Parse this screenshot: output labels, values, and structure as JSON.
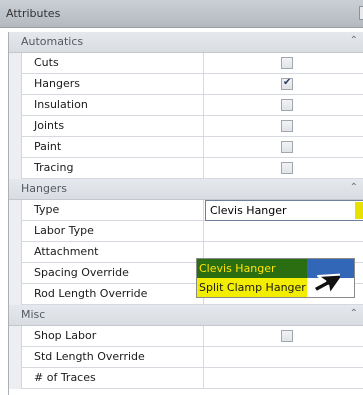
{
  "window": {
    "title": "Attributes"
  },
  "categories": {
    "automatics": {
      "label": "Automatics",
      "collapse_glyph": "⌃"
    },
    "hangers": {
      "label": "Hangers",
      "collapse_glyph": "⌃"
    },
    "misc": {
      "label": "Misc",
      "collapse_glyph": "⌃"
    }
  },
  "automatics_rows": [
    {
      "label": "Cuts",
      "checked": false
    },
    {
      "label": "Hangers",
      "checked": true
    },
    {
      "label": "Insulation",
      "checked": false
    },
    {
      "label": "Joints",
      "checked": false
    },
    {
      "label": "Paint",
      "checked": false
    },
    {
      "label": "Tracing",
      "checked": false
    }
  ],
  "hangers_rows": [
    {
      "label": "Type"
    },
    {
      "label": "Labor Type"
    },
    {
      "label": "Attachment"
    },
    {
      "label": "Spacing Override"
    },
    {
      "label": "Rod Length Override"
    }
  ],
  "type_field": {
    "value": "Clevis Hanger"
  },
  "dropdown": {
    "options": [
      "Clevis Hanger",
      "Split Clamp Hanger"
    ],
    "selected": "Clevis Hanger"
  },
  "misc_rows": [
    {
      "label": "Shop Labor",
      "checked": false
    },
    {
      "label": "Std Length Override"
    },
    {
      "label": "# of Traces"
    }
  ],
  "colors": {
    "highlight_green": "#2b6d11",
    "highlight_yellow": "#f3ee00",
    "selection_blue": "#3267b7",
    "check_mark": "#2b3c66"
  },
  "icons": {
    "collapse": "chevron-up-icon",
    "checkbox": "checkbox-icon",
    "dropdown": "dropdown-arrow-icon",
    "cursor": "mouse-cursor-icon"
  }
}
